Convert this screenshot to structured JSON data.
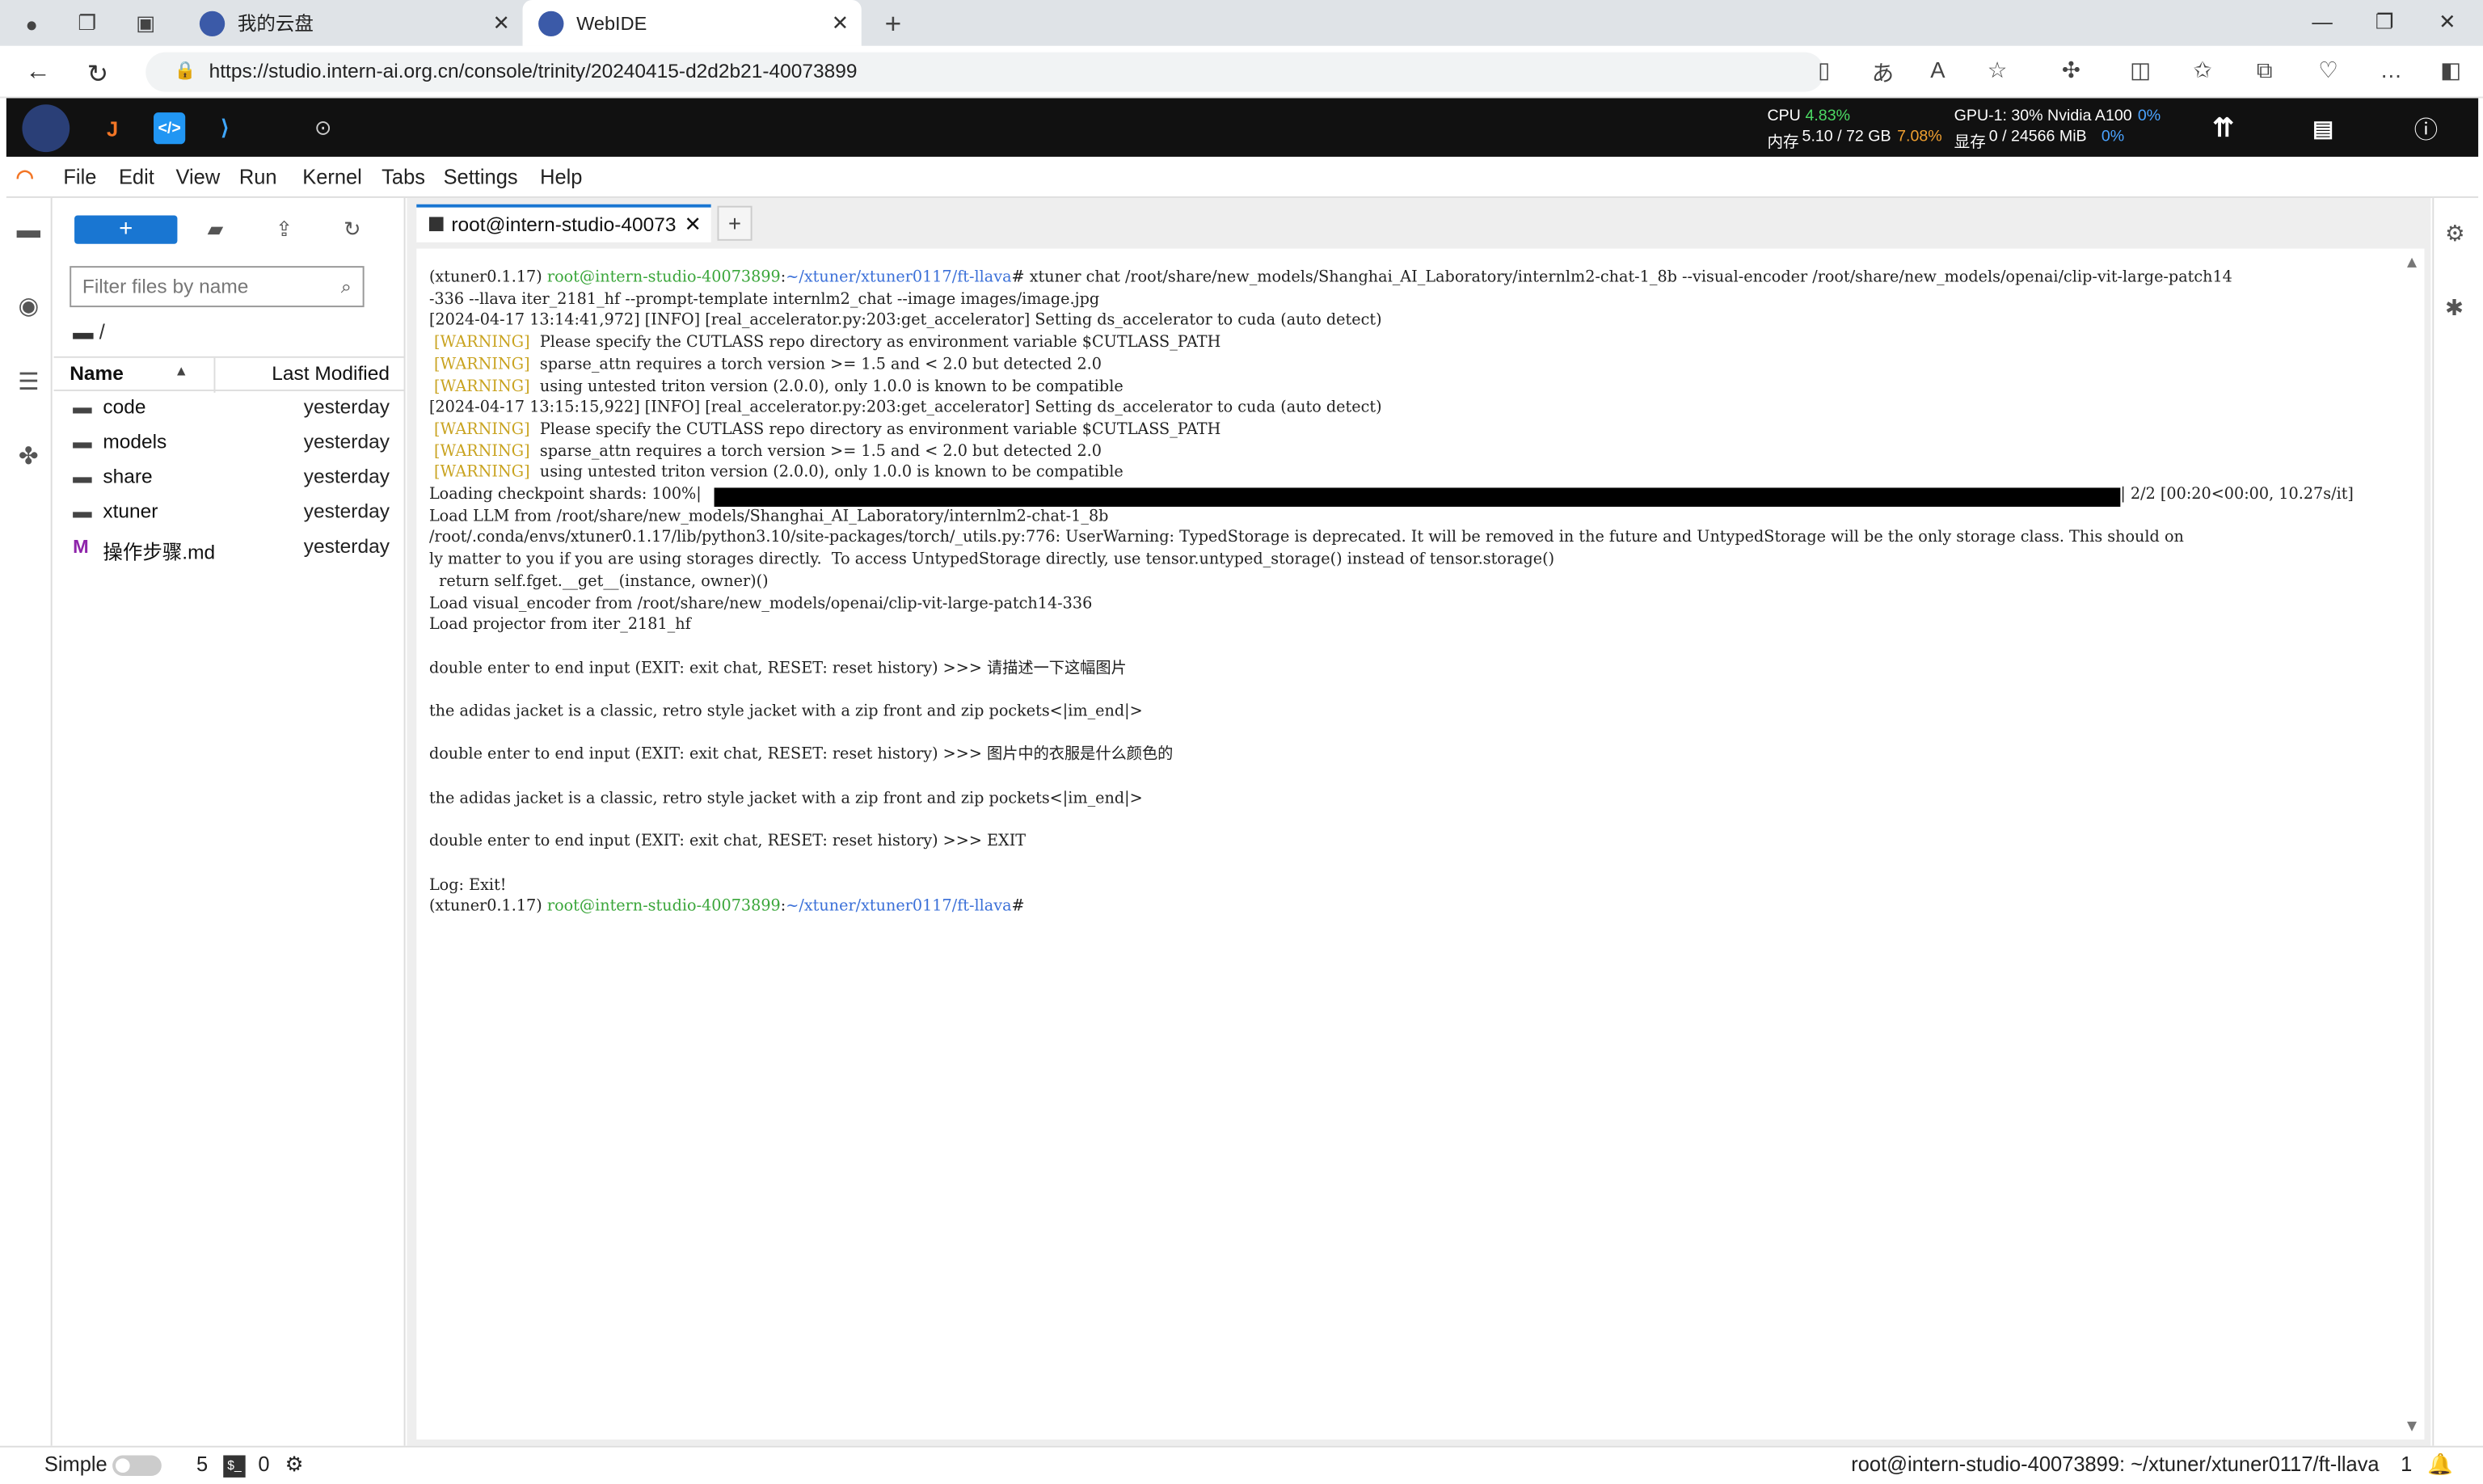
{
  "browser": {
    "tabs": [
      {
        "title": "我的云盘"
      },
      {
        "title": "WebIDE"
      }
    ],
    "url": "https://studio.intern-ai.org.cn/console/trinity/20240415-d2d2b21-40073899"
  },
  "resources": {
    "cpu_label": "CPU",
    "cpu_value": "4.83%",
    "mem_label": "内存",
    "mem_value": "5.10 / 72 GB",
    "mem_pct": "7.08%",
    "gpu_label": "GPU-1: 30% Nvidia A100",
    "gpu_pct": "0%",
    "vram_label": "显存",
    "vram_value": "0 / 24566 MiB",
    "vram_pct": "0%"
  },
  "menu": [
    "File",
    "Edit",
    "View",
    "Run",
    "Kernel",
    "Tabs",
    "Settings",
    "Help"
  ],
  "file_browser": {
    "new_label": "+",
    "filter_placeholder": "Filter files by name",
    "breadcrumb": "/",
    "col_name": "Name",
    "col_modified": "Last Modified",
    "files": [
      {
        "name": "code",
        "modified": "yesterday",
        "icon": "folder-icon"
      },
      {
        "name": "models",
        "modified": "yesterday",
        "icon": "folder-icon"
      },
      {
        "name": "share",
        "modified": "yesterday",
        "icon": "folder-icon"
      },
      {
        "name": "xtuner",
        "modified": "yesterday",
        "icon": "folder-icon"
      },
      {
        "name": "操作步骤.md",
        "modified": "yesterday",
        "icon": "markdown-icon"
      }
    ]
  },
  "terminal": {
    "tab_label": "root@intern-studio-40073",
    "prompt_env": "(xtuner0.1.17)",
    "prompt_user": "root@intern-studio-40073899",
    "prompt_path": "~/xtuner/xtuner0117/ft-llava",
    "command": "# xtuner chat /root/share/new_models/Shanghai_AI_Laboratory/internlm2-chat-1_8b --visual-encoder /root/share/new_models/openai/clip-vit-large-patch14",
    "command_cont": "-336 --llava iter_2181_hf --prompt-template internlm2_chat --image images/image.jpg",
    "lines": [
      "[2024-04-17 13:14:41,972] [INFO] [real_accelerator.py:203:get_accelerator] Setting ds_accelerator to cuda (auto detect)",
      "Please specify the CUTLASS repo directory as environment variable $CUTLASS_PATH",
      "sparse_attn requires a torch version >= 1.5 and < 2.0 but detected 2.0",
      "using untested triton version (2.0.0), only 1.0.0 is known to be compatible",
      "[2024-04-17 13:15:15,922] [INFO] [real_accelerator.py:203:get_accelerator] Setting ds_accelerator to cuda (auto detect)",
      "Please specify the CUTLASS repo directory as environment variable $CUTLASS_PATH",
      "sparse_attn requires a torch version >= 1.5 and < 2.0 but detected 2.0",
      "using untested triton version (2.0.0), only 1.0.0 is known to be compatible"
    ],
    "warning_tag": "[WARNING]",
    "shards_label": "Loading checkpoint shards: 100%|",
    "shards_progress": 1.0,
    "shards_tail": "| 2/2 [00:20<00:00, 10.27s/it]",
    "output": [
      "Load LLM from /root/share/new_models/Shanghai_AI_Laboratory/internlm2-chat-1_8b",
      "/root/.conda/envs/xtuner0.1.17/lib/python3.10/site-packages/torch/_utils.py:776: UserWarning: TypedStorage is deprecated. It will be removed in the future and UntypedStorage will be the only storage class. This should on",
      "ly matter to you if you are using storages directly.  To access UntypedStorage directly, use tensor.untyped_storage() instead of tensor.storage()",
      "  return self.fget.__get__(instance, owner)()",
      "Load visual_encoder from /root/share/new_models/openai/clip-vit-large-patch14-336",
      "Load projector from iter_2181_hf",
      "",
      "double enter to end input (EXIT: exit chat, RESET: reset history) >>> 请描述一下这幅图片",
      "",
      "the adidas jacket is a classic, retro style jacket with a zip front and zip pockets<|im_end|>",
      "",
      "double enter to end input (EXIT: exit chat, RESET: reset history) >>> 图片中的衣服是什么颜色的",
      "",
      "the adidas jacket is a classic, retro style jacket with a zip front and zip pockets<|im_end|>",
      "",
      "double enter to end input (EXIT: exit chat, RESET: reset history) >>> EXIT",
      "",
      "Log: Exit!"
    ],
    "final_prompt_suffix": "#"
  },
  "status": {
    "mode_label": "Simple",
    "count1": "5",
    "count2": "0",
    "path": "root@intern-studio-40073899: ~/xtuner/xtuner0117/ft-llava",
    "num": "1"
  }
}
